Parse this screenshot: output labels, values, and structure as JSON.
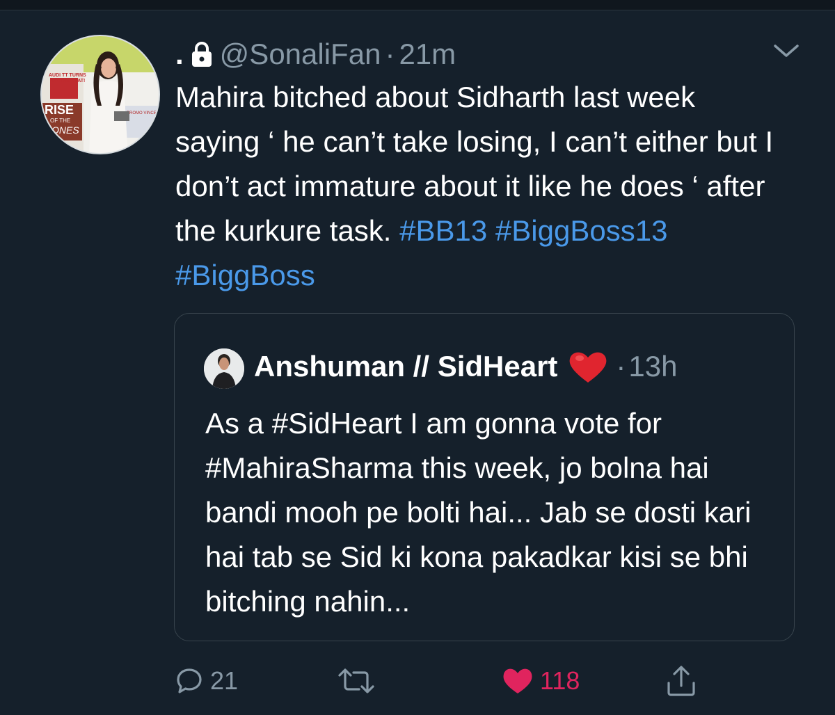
{
  "tweet": {
    "display_name": ".",
    "handle": "@SonaliFan",
    "separator": "·",
    "time": "21m",
    "text_parts": [
      "Mahira bitched about Sidharth last week saying ‘ he can’t take losing, I can’t either but I don’t act immature about it like he does ‘ after the kurkure task.",
      "#BB13",
      "#BiggBoss13",
      "#BiggBoss"
    ],
    "avatar": {
      "cover_text": [
        "RISE",
        "OF THE",
        "ONES"
      ],
      "cover_small": [
        "AUDI TT TURNS",
        "UP THE HEAT!"
      ],
      "cover_badge": "PROMO VINCE"
    }
  },
  "quoted_tweet": {
    "display_name": "Anshuman // SidHeart",
    "emoji": "red-heart-emoji",
    "separator": "·",
    "time": "13h",
    "text": "As a #SidHeart I am gonna vote for #MahiraSharma this week, jo bolna hai bandi mooh pe bolti hai... Jab se dosti kari hai tab se Sid ki kona pakadkar kisi se bhi bitching nahin..."
  },
  "actions": {
    "reply_count": "21",
    "retweet_count": "",
    "like_count": "118",
    "like_active": true
  },
  "colors": {
    "background": "#15202b",
    "text": "#ffffff",
    "secondary": "#8899a6",
    "hashtag": "#4a99e9",
    "like": "#e0245e",
    "border": "#38444d"
  },
  "icons": [
    "lock-icon",
    "chevron-down-icon",
    "reply-icon",
    "retweet-icon",
    "heart-icon",
    "share-icon"
  ]
}
